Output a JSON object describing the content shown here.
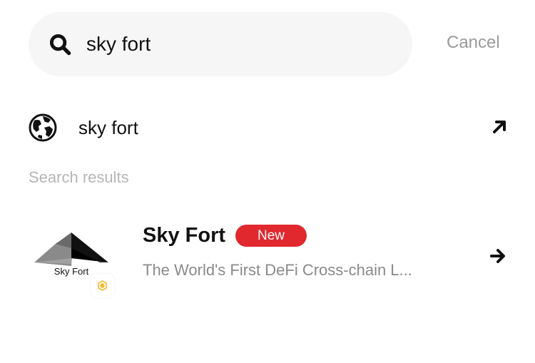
{
  "search": {
    "query": "sky fort",
    "cancel_label": "Cancel"
  },
  "web_suggestion": {
    "label": "sky fort",
    "icon": "globe-icon",
    "action_icon": "arrow-up-right-icon"
  },
  "section": {
    "header": "Search results"
  },
  "results": [
    {
      "title": "Sky Fort",
      "badge": "New",
      "description": "The World's First DeFi Cross-chain L...",
      "logo_text": "Sky Fort",
      "action_icon": "arrow-right-icon"
    }
  ],
  "colors": {
    "accent_badge": "#e0282e",
    "search_bg": "#f6f6f6",
    "muted_text": "#9a9a9a",
    "chain_badge": "#f3ba2f"
  }
}
